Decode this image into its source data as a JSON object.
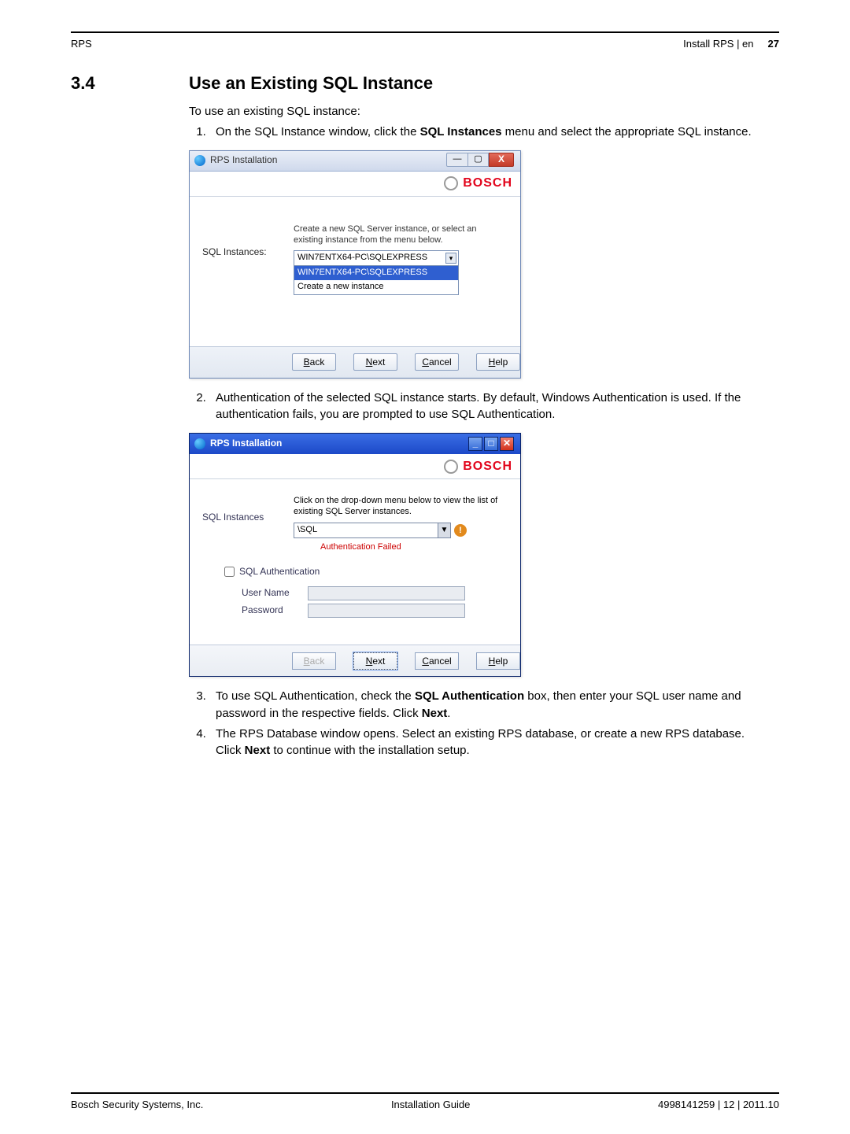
{
  "header": {
    "left": "RPS",
    "right_section": "Install RPS | en",
    "page_num": "27"
  },
  "section": {
    "number": "3.4",
    "title": "Use an Existing SQL Instance"
  },
  "intro": "To use an existing SQL instance:",
  "steps": {
    "s1_a": "On the SQL Instance window, click the ",
    "s1_b": "SQL Instances",
    "s1_c": " menu and select the appropriate SQL instance.",
    "s2": "Authentication of the selected SQL instance starts. By default, Windows Authentication is used. If the authentication fails, you are prompted to use SQL Authentication.",
    "s3_a": "To use SQL Authentication, check the ",
    "s3_b": "SQL Authentication",
    "s3_c": " box, then enter your SQL user name and password in the respective fields. Click ",
    "s3_d": "Next",
    "s3_e": ".",
    "s4_a": "The RPS Database window opens. Select an existing RPS database, or create a new RPS database. Click ",
    "s4_b": "Next",
    "s4_c": " to continue with the installation setup."
  },
  "shot1": {
    "title": "RPS Installation",
    "brand": "BOSCH",
    "label": "SQL Instances:",
    "instruction": "Create a new SQL Server instance, or select an existing instance from the menu below.",
    "combo_value": "WIN7ENTX64-PC\\SQLEXPRESS",
    "list_selected": "WIN7ENTX64-PC\\SQLEXPRESS",
    "list_opt2": "Create a new instance",
    "buttons": {
      "back": "Back",
      "next": "Next",
      "cancel": "Cancel",
      "help": "Help"
    }
  },
  "shot2": {
    "title": "RPS Installation",
    "brand": "BOSCH",
    "label": "SQL Instances",
    "instruction": "Click on the drop-down menu below to view the list of existing SQL Server instances.",
    "combo_value": "\\SQL",
    "auth_failed": "Authentication Failed",
    "sql_auth_label": "SQL Authentication",
    "user_label": "User Name",
    "pass_label": "Password",
    "buttons": {
      "back": "Back",
      "next": "Next",
      "cancel": "Cancel",
      "help": "Help"
    }
  },
  "footer": {
    "left": "Bosch Security Systems, Inc.",
    "center": "Installation Guide",
    "right": "4998141259 | 12 | 2011.10"
  }
}
